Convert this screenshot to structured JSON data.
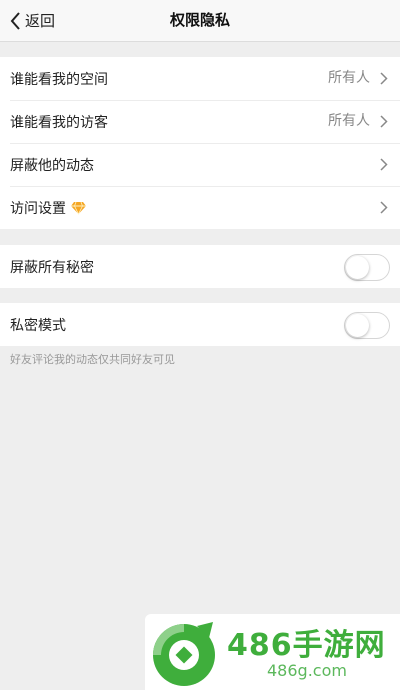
{
  "nav": {
    "back_label": "返回",
    "title": "权限隐私"
  },
  "group1": {
    "rows": [
      {
        "label": "谁能看我的空间",
        "value": "所有人"
      },
      {
        "label": "谁能看我的访客",
        "value": "所有人"
      },
      {
        "label": "屏蔽他的动态"
      },
      {
        "label": "访问设置"
      }
    ]
  },
  "group2": {
    "label": "屏蔽所有秘密",
    "toggle_on": false
  },
  "group3": {
    "label": "私密模式",
    "toggle_on": false,
    "hint": "好友评论我的动态仅共同好友可见"
  },
  "watermark": {
    "title": "486手游网",
    "url": "486g.com"
  },
  "colors": {
    "background": "#eeeeee",
    "diamond": "#f5a623",
    "watermark_green": "#3fae3c"
  },
  "icons": [
    "back-chevron-icon",
    "chevron-right-icon",
    "diamond-icon",
    "toggle-switch"
  ]
}
